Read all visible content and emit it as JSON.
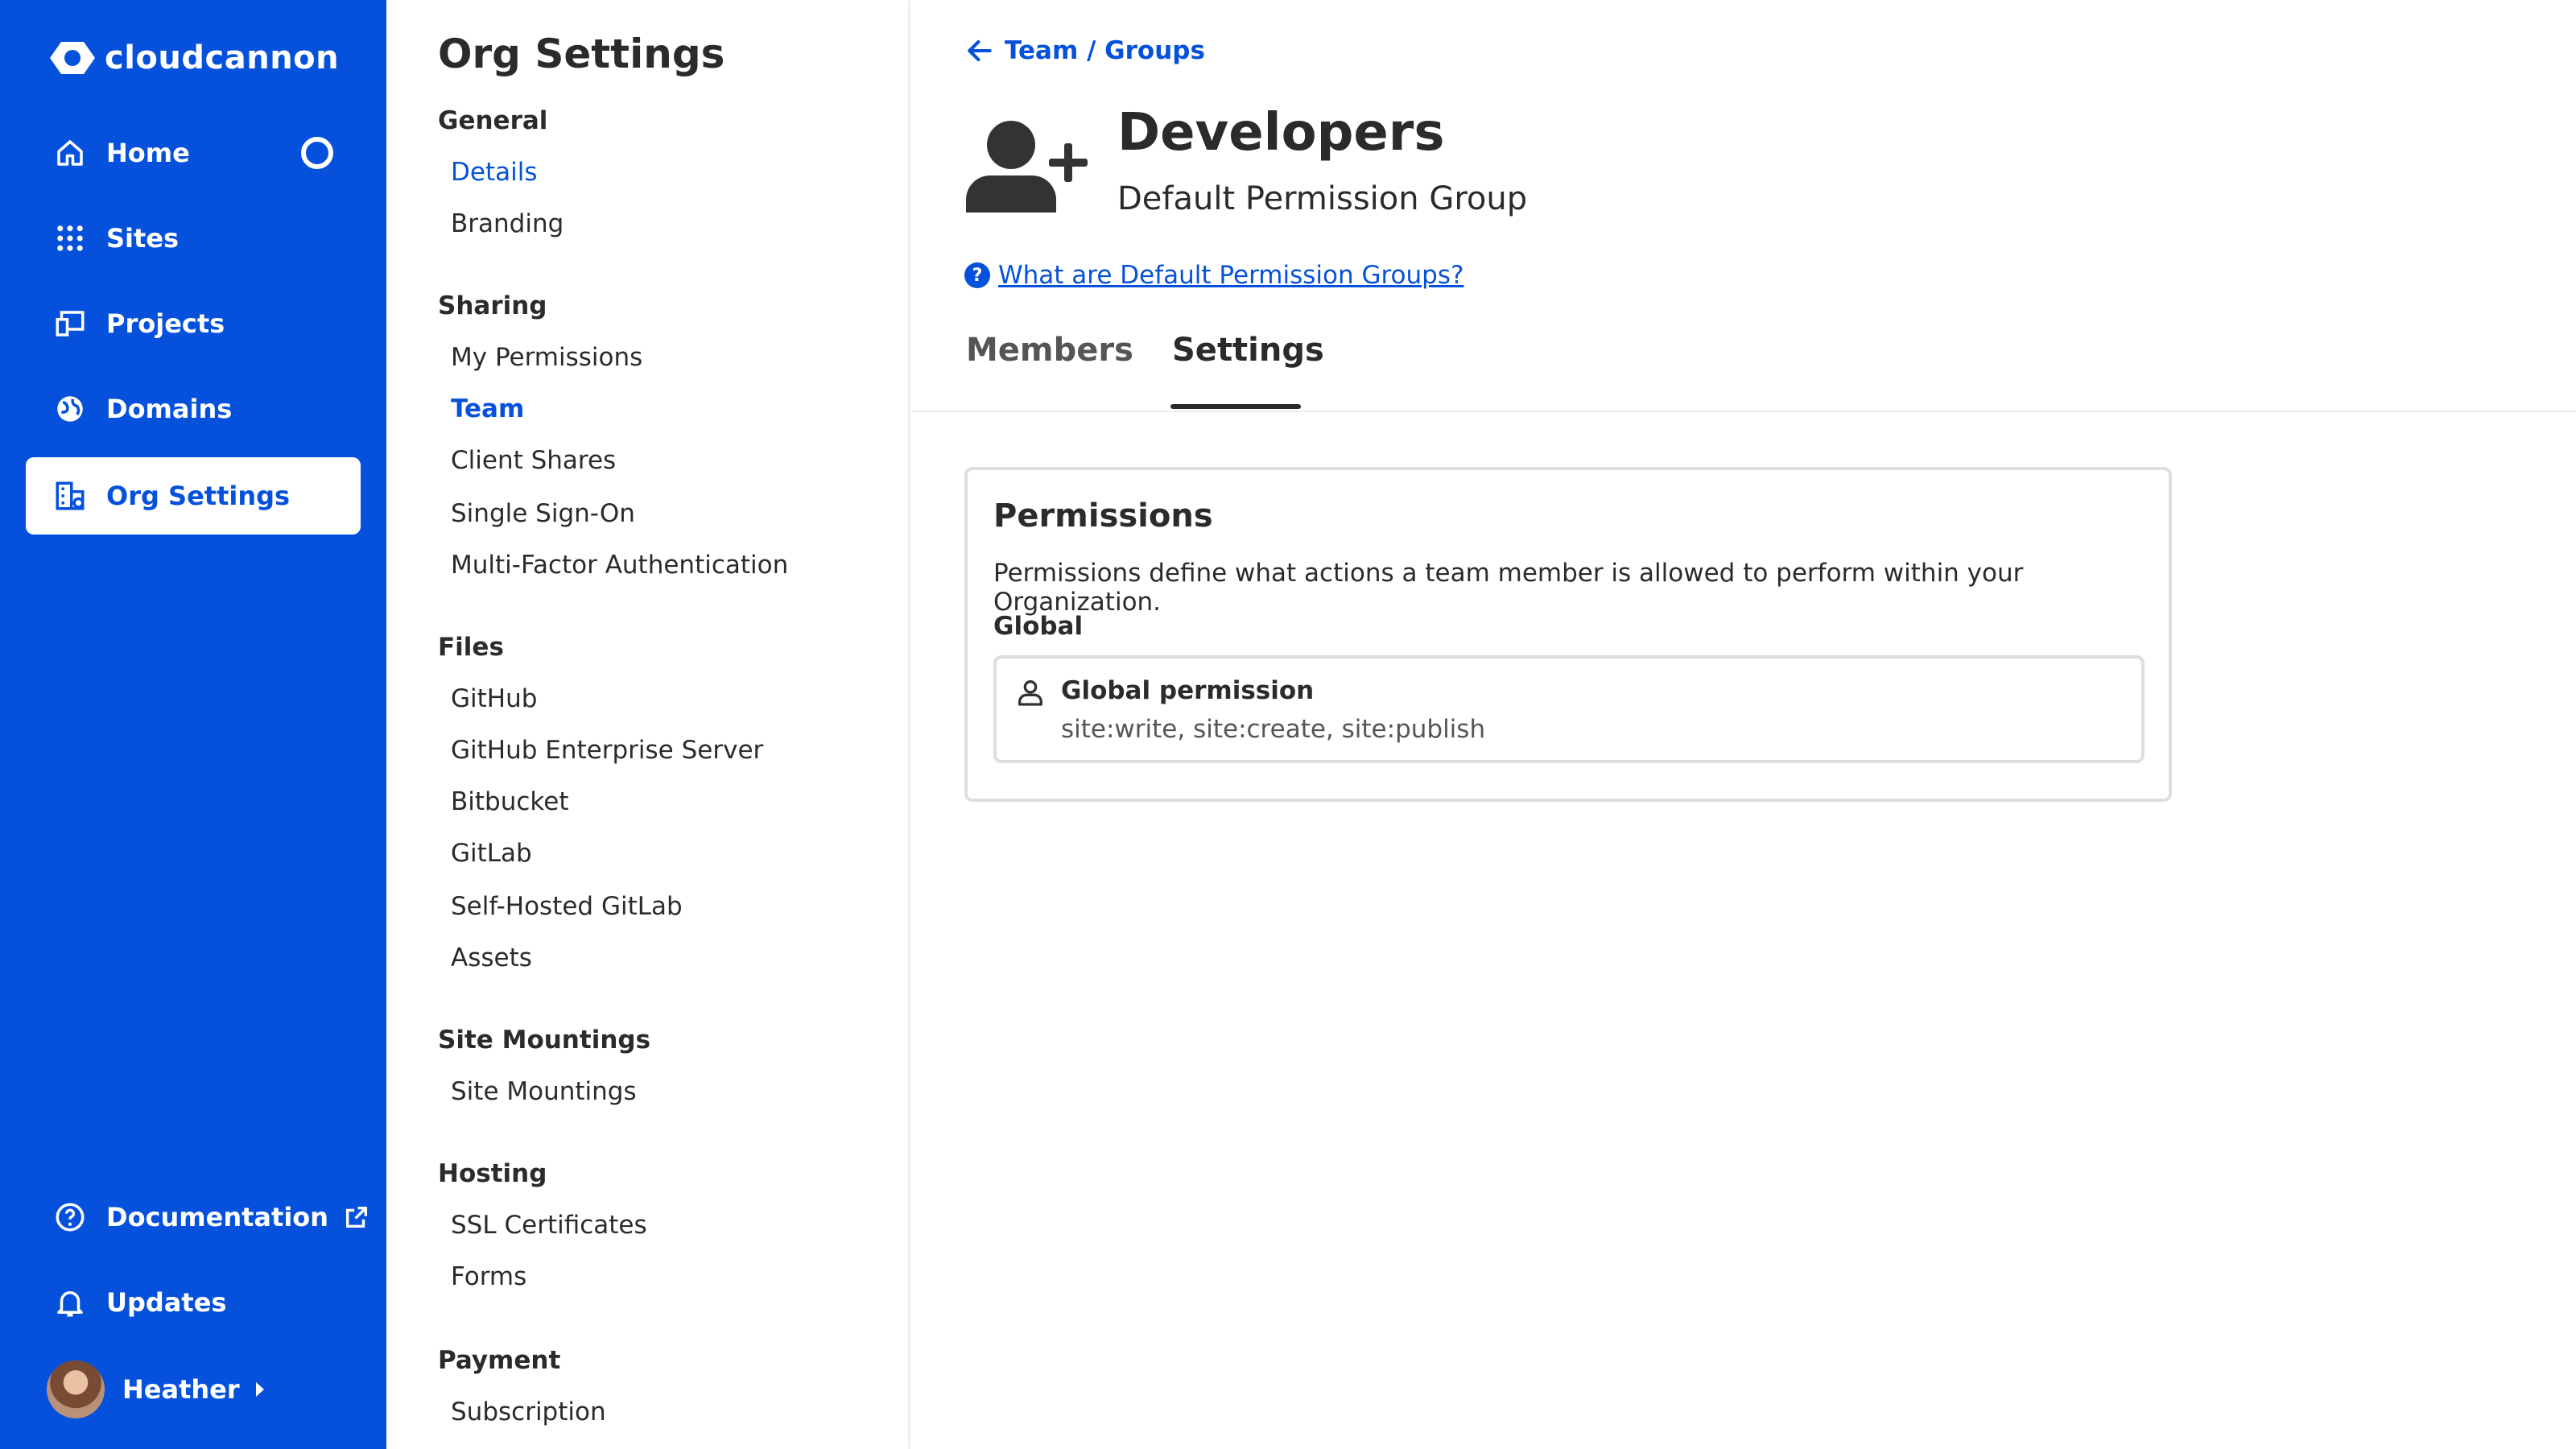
{
  "app": {
    "brand": "cloudcannon",
    "accent": "#0551db"
  },
  "nav": {
    "items": [
      {
        "label": "Home",
        "icon": "home-icon"
      },
      {
        "label": "Sites",
        "icon": "grid-dots-icon"
      },
      {
        "label": "Projects",
        "icon": "devices-icon"
      },
      {
        "label": "Domains",
        "icon": "globe-icon"
      },
      {
        "label": "Org Settings",
        "icon": "building-icon",
        "active": true
      }
    ],
    "bottom": [
      {
        "label": "Documentation",
        "icon": "help-circle-icon"
      },
      {
        "label": "Updates",
        "icon": "bell-icon"
      }
    ],
    "user": {
      "name": "Heather"
    }
  },
  "menu": {
    "title": "Org Settings",
    "sections": [
      {
        "title": "General",
        "items": [
          "Details",
          "Branding"
        ]
      },
      {
        "title": "Sharing",
        "items": [
          "My Permissions",
          "Team",
          "Client Shares",
          "Single Sign-On",
          "Multi-Factor Authentication"
        ]
      },
      {
        "title": "Files",
        "items": [
          "GitHub",
          "GitHub Enterprise Server",
          "Bitbucket",
          "GitLab",
          "Self-Hosted GitLab",
          "Assets"
        ]
      },
      {
        "title": "Site Mountings",
        "items": [
          "Site Mountings"
        ]
      },
      {
        "title": "Hosting",
        "items": [
          "SSL Certificates",
          "Forms"
        ]
      },
      {
        "title": "Payment",
        "items": [
          "Subscription"
        ]
      }
    ]
  },
  "main": {
    "breadcrumb": "Team / Groups",
    "group": {
      "name": "Developers",
      "subtitle": "Default Permission Group"
    },
    "help_link": "What are Default Permission Groups?",
    "tabs": [
      {
        "label": "Members"
      },
      {
        "label": "Settings",
        "active": true
      }
    ],
    "permissions": {
      "title": "Permissions",
      "description": "Permissions define what actions a team member is allowed to perform within your Organization.",
      "scope_label": "Global",
      "entry": {
        "name": "Global permission",
        "scopes": "site:write, site:create, site:publish"
      }
    }
  }
}
